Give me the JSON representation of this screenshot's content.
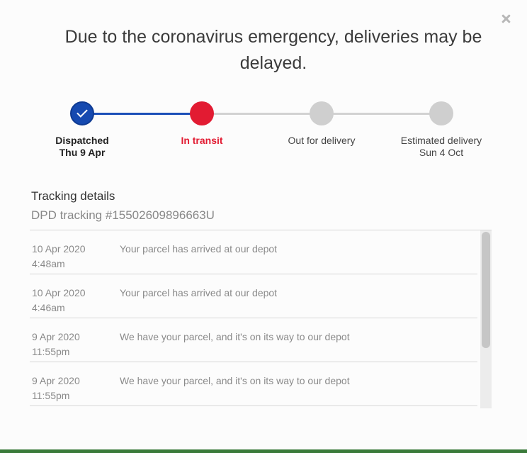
{
  "notice": "Due to the coronavirus emergency, deliveries may be delayed.",
  "steps": [
    {
      "label": "Dispatched",
      "sub": "Thu 9 Apr",
      "status": "complete"
    },
    {
      "label": "In transit",
      "sub": "",
      "status": "current"
    },
    {
      "label": "Out for delivery",
      "sub": "",
      "status": "pending"
    },
    {
      "label": "Estimated delivery",
      "sub": "Sun 4 Oct",
      "status": "pending"
    }
  ],
  "details": {
    "title": "Tracking details",
    "tracking_number": "DPD tracking #15502609896663U"
  },
  "events": [
    {
      "date": "10 Apr 2020",
      "time": "4:48am",
      "message": "Your parcel has arrived at our depot"
    },
    {
      "date": "10 Apr 2020",
      "time": "4:46am",
      "message": "Your parcel has arrived at our depot"
    },
    {
      "date": "9 Apr 2020",
      "time": "11:55pm",
      "message": "We have your parcel, and it's on its way to our depot"
    },
    {
      "date": "9 Apr 2020",
      "time": "11:55pm",
      "message": "We have your parcel, and it's on its way to our depot"
    }
  ],
  "colors": {
    "complete": "#1549b0",
    "current": "#e21b32",
    "pending": "#cfcfcf"
  },
  "icons": {
    "close": "close-icon",
    "check": "check-icon"
  }
}
